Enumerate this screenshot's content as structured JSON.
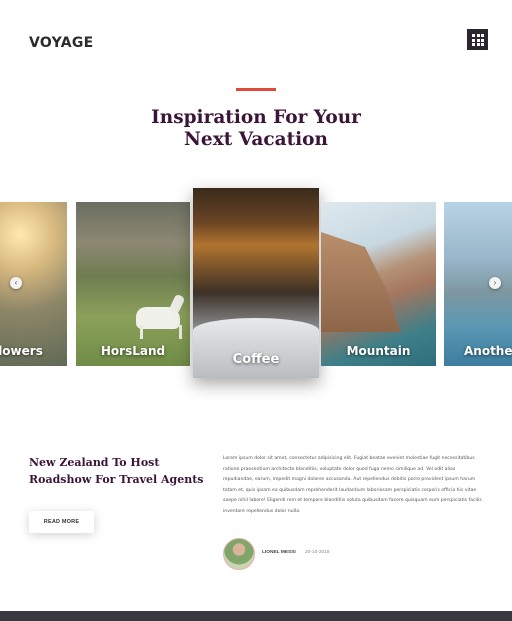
{
  "header": {
    "logo": "VOYAGE",
    "menu_icon": "grid-icon"
  },
  "hero": {
    "title_line1": "Inspiration For Your",
    "title_line2": "Next Vacation",
    "accent_color": "#e0483c"
  },
  "carousel": {
    "slides": [
      {
        "label": "Flowers"
      },
      {
        "label": "HorsLand"
      },
      {
        "label": "Coffee",
        "active": true
      },
      {
        "label": "Mountain"
      },
      {
        "label": "Another"
      }
    ],
    "prev_icon": "chevron-left-icon",
    "next_icon": "chevron-right-icon"
  },
  "post": {
    "title": "New Zealand To Host Roadshow For Travel Agents",
    "read_more": "READ MORE",
    "body": "Lorem ipsum dolor sit amet, consectetur adipisicing elit. Fugiat beatae eveniet molestiae fugit necessitatibus ratione praesentium architecto blanditiis, voluptate dolor quod fuga nemo similique ad. Vel odit alias repudiandae, earum, impedit magni dolores accusanda. Aut repellendus debitis porro provident ipsum harum totam et, quis ipsam ea quibusdam reprehenderit laudantium laboriosam perspiciatis corporis officia hic vitae saepe nihil labore! Eligendi rem et tempore blanditiis soluta quibusdam facere quisquam eum perspiciatis facilis inventore repellendus dolor nulla.",
    "author": "LIONEL MESSI",
    "date": "20-10-2018"
  },
  "colors": {
    "title": "#3b1537",
    "footer": "#3a3840"
  }
}
